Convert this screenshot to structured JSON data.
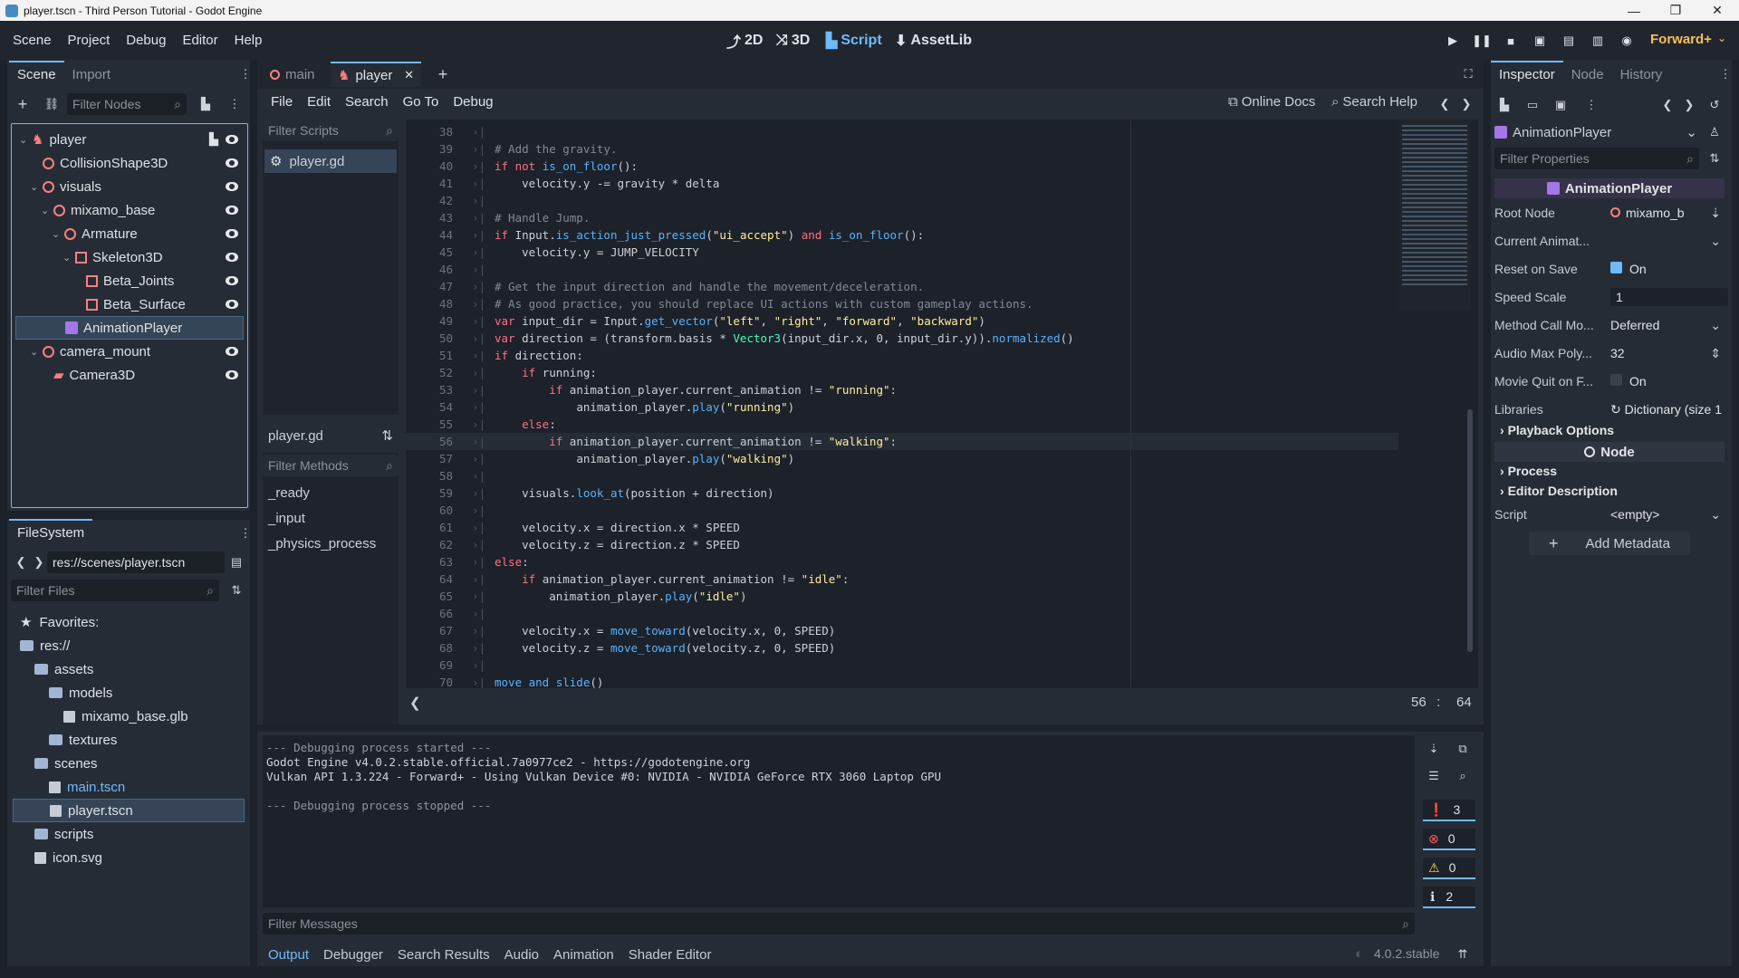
{
  "window": {
    "title": "player.tscn - Third Person Tutorial - Godot Engine",
    "controls": [
      "—",
      "❐",
      "✕"
    ]
  },
  "menu": {
    "items": [
      "Scene",
      "Project",
      "Debug",
      "Editor",
      "Help"
    ]
  },
  "workspaces": [
    "2D",
    "3D",
    "Script",
    "AssetLib"
  ],
  "renderer": "Forward+",
  "scene_dock": {
    "tabs": [
      "Scene",
      "Import"
    ],
    "filter_placeholder": "Filter Nodes",
    "nodes": [
      {
        "label": "player",
        "depth": 0,
        "selected": false,
        "expanded": true,
        "icon": "character-body-icon"
      },
      {
        "label": "CollisionShape3D",
        "depth": 1,
        "selected": false,
        "icon": "collision-shape-icon"
      },
      {
        "label": "visuals",
        "depth": 1,
        "selected": false,
        "expanded": true,
        "icon": "node3d-icon"
      },
      {
        "label": "mixamo_base",
        "depth": 2,
        "selected": false,
        "expanded": true,
        "icon": "node3d-icon"
      },
      {
        "label": "Armature",
        "depth": 3,
        "selected": false,
        "expanded": true,
        "icon": "node3d-icon"
      },
      {
        "label": "Skeleton3D",
        "depth": 4,
        "selected": false,
        "expanded": true,
        "icon": "skeleton-icon"
      },
      {
        "label": "Beta_Joints",
        "depth": 5,
        "selected": false,
        "icon": "mesh-icon"
      },
      {
        "label": "Beta_Surface",
        "depth": 5,
        "selected": false,
        "icon": "mesh-icon"
      },
      {
        "label": "AnimationPlayer",
        "depth": 3,
        "selected": true,
        "icon": "animation-player-icon"
      },
      {
        "label": "camera_mount",
        "depth": 1,
        "selected": false,
        "expanded": true,
        "icon": "node3d-icon"
      },
      {
        "label": "Camera3D",
        "depth": 2,
        "selected": false,
        "icon": "camera-icon"
      }
    ]
  },
  "filesystem": {
    "tab": "FileSystem",
    "path": "res://scenes/player.tscn",
    "filter_placeholder": "Filter Files",
    "items": [
      {
        "label": "Favorites:",
        "depth": 0,
        "kind": "favorites"
      },
      {
        "label": "res://",
        "depth": 0,
        "kind": "folder"
      },
      {
        "label": "assets",
        "depth": 1,
        "kind": "folder"
      },
      {
        "label": "models",
        "depth": 2,
        "kind": "folder"
      },
      {
        "label": "mixamo_base.glb",
        "depth": 3,
        "kind": "file"
      },
      {
        "label": "textures",
        "depth": 2,
        "kind": "folder"
      },
      {
        "label": "scenes",
        "depth": 1,
        "kind": "folder"
      },
      {
        "label": "main.tscn",
        "depth": 2,
        "kind": "file",
        "highlight": true
      },
      {
        "label": "player.tscn",
        "depth": 2,
        "kind": "file",
        "selected": true
      },
      {
        "label": "scripts",
        "depth": 1,
        "kind": "folder"
      },
      {
        "label": "icon.svg",
        "depth": 1,
        "kind": "file"
      }
    ]
  },
  "editor_tabs": [
    {
      "label": "main",
      "active": false
    },
    {
      "label": "player",
      "active": true
    }
  ],
  "script_menu": [
    "File",
    "Edit",
    "Search",
    "Go To",
    "Debug"
  ],
  "script_help": {
    "online_docs": "Online Docs",
    "search_help": "Search Help"
  },
  "scripts_panel": {
    "filter_placeholder": "Filter Scripts",
    "scripts": [
      "player.gd"
    ],
    "current": "player.gd",
    "methods_filter_placeholder": "Filter Methods",
    "methods": [
      "_ready",
      "_input",
      "_physics_process"
    ]
  },
  "code": {
    "cursor_line": "56",
    "cursor_col": "64",
    "highlight_line": 56,
    "lines": [
      {
        "n": 38,
        "t": []
      },
      {
        "n": 39,
        "t": [
          [
            "cm",
            "# Add the gravity."
          ]
        ]
      },
      {
        "n": 40,
        "t": [
          [
            "kw",
            "if not "
          ],
          [
            "fn",
            "is_on_floor"
          ],
          [
            "",
            "():"
          ]
        ]
      },
      {
        "n": 41,
        "t": [
          [
            "",
            "\tvelocity.y -= gravity * delta"
          ]
        ]
      },
      {
        "n": 42,
        "t": []
      },
      {
        "n": 43,
        "t": [
          [
            "cm",
            "# Handle Jump."
          ]
        ]
      },
      {
        "n": 44,
        "t": [
          [
            "kw",
            "if "
          ],
          [
            "",
            "Input."
          ],
          [
            "fn",
            "is_action_just_pressed"
          ],
          [
            "",
            "("
          ],
          [
            "str",
            "\"ui_accept\""
          ],
          [
            "",
            ") "
          ],
          [
            "kw",
            "and "
          ],
          [
            "fn",
            "is_on_floor"
          ],
          [
            "",
            "():"
          ]
        ]
      },
      {
        "n": 45,
        "t": [
          [
            "",
            "\tvelocity.y = JUMP_VELOCITY"
          ]
        ]
      },
      {
        "n": 46,
        "t": []
      },
      {
        "n": 47,
        "t": [
          [
            "cm",
            "# Get the input direction and handle the movement/deceleration."
          ]
        ]
      },
      {
        "n": 48,
        "t": [
          [
            "cm",
            "# As good practice, you should replace UI actions with custom gameplay actions."
          ]
        ]
      },
      {
        "n": 49,
        "t": [
          [
            "kw",
            "var "
          ],
          [
            "",
            "input_dir = Input."
          ],
          [
            "fn",
            "get_vector"
          ],
          [
            "",
            "("
          ],
          [
            "str",
            "\"left\""
          ],
          [
            "",
            ", "
          ],
          [
            "str",
            "\"right\""
          ],
          [
            "",
            ", "
          ],
          [
            "str",
            "\"forward\""
          ],
          [
            "",
            ", "
          ],
          [
            "str",
            "\"backward\""
          ],
          [
            "",
            ")"
          ]
        ]
      },
      {
        "n": 50,
        "t": [
          [
            "kw",
            "var "
          ],
          [
            "",
            "direction = (transform.basis * "
          ],
          [
            "tp",
            "Vector3"
          ],
          [
            "",
            "(input_dir.x, 0, input_dir.y))."
          ],
          [
            "fn",
            "normalized"
          ],
          [
            "",
            "()"
          ]
        ]
      },
      {
        "n": 51,
        "t": [
          [
            "kw",
            "if "
          ],
          [
            "",
            "direction:"
          ]
        ]
      },
      {
        "n": 52,
        "t": [
          [
            "",
            "\t"
          ],
          [
            "kw",
            "if "
          ],
          [
            "",
            "running:"
          ]
        ]
      },
      {
        "n": 53,
        "t": [
          [
            "",
            "\t\t"
          ],
          [
            "kw",
            "if "
          ],
          [
            "",
            "animation_player.current_animation != "
          ],
          [
            "str",
            "\"running\""
          ],
          [
            "",
            ":"
          ]
        ]
      },
      {
        "n": 54,
        "t": [
          [
            "",
            "\t\t\tanimation_player."
          ],
          [
            "fn",
            "play"
          ],
          [
            "",
            "("
          ],
          [
            "str",
            "\"running\""
          ],
          [
            "",
            ")"
          ]
        ]
      },
      {
        "n": 55,
        "t": [
          [
            "",
            "\t"
          ],
          [
            "kw",
            "else"
          ],
          [
            "",
            ":"
          ]
        ]
      },
      {
        "n": 56,
        "t": [
          [
            "",
            "\t\t"
          ],
          [
            "kw",
            "if "
          ],
          [
            "",
            "animation_player.current_animation != "
          ],
          [
            "str",
            "\"walking\""
          ],
          [
            "",
            ":"
          ]
        ]
      },
      {
        "n": 57,
        "t": [
          [
            "",
            "\t\t\tanimation_player."
          ],
          [
            "fn",
            "play"
          ],
          [
            "",
            "("
          ],
          [
            "str",
            "\"walking\""
          ],
          [
            "",
            ")"
          ]
        ]
      },
      {
        "n": 58,
        "t": []
      },
      {
        "n": 59,
        "t": [
          [
            "",
            "\tvisuals."
          ],
          [
            "fn",
            "look_at"
          ],
          [
            "",
            "(position + direction)"
          ]
        ]
      },
      {
        "n": 60,
        "t": []
      },
      {
        "n": 61,
        "t": [
          [
            "",
            "\tvelocity.x = direction.x * SPEED"
          ]
        ]
      },
      {
        "n": 62,
        "t": [
          [
            "",
            "\tvelocity.z = direction.z * SPEED"
          ]
        ]
      },
      {
        "n": 63,
        "t": [
          [
            "kw",
            "else"
          ],
          [
            "",
            ":"
          ]
        ]
      },
      {
        "n": 64,
        "t": [
          [
            "",
            "\t"
          ],
          [
            "kw",
            "if "
          ],
          [
            "",
            "animation_player.current_animation != "
          ],
          [
            "str",
            "\"idle\""
          ],
          [
            "",
            ":"
          ]
        ]
      },
      {
        "n": 65,
        "t": [
          [
            "",
            "\t\tanimation_player."
          ],
          [
            "fn",
            "play"
          ],
          [
            "",
            "("
          ],
          [
            "str",
            "\"idle\""
          ],
          [
            "",
            ")"
          ]
        ]
      },
      {
        "n": 66,
        "t": []
      },
      {
        "n": 67,
        "t": [
          [
            "",
            "\tvelocity.x = "
          ],
          [
            "fn",
            "move_toward"
          ],
          [
            "",
            "(velocity.x, 0, SPEED)"
          ]
        ]
      },
      {
        "n": 68,
        "t": [
          [
            "",
            "\tvelocity.z = "
          ],
          [
            "fn",
            "move_toward"
          ],
          [
            "",
            "(velocity.z, 0, SPEED)"
          ]
        ]
      },
      {
        "n": 69,
        "t": []
      },
      {
        "n": 70,
        "t": [
          [
            "fn",
            "move_and_slide"
          ],
          [
            "",
            "()"
          ]
        ]
      }
    ]
  },
  "output": {
    "lines": [
      "--- Debugging process started ---",
      "Godot Engine v4.0.2.stable.official.7a0977ce2 - https://godotengine.org",
      "Vulkan API 1.3.224 - Forward+ - Using Vulkan Device #0: NVIDIA - NVIDIA GeForce RTX 3060 Laptop GPU",
      "",
      "--- Debugging process stopped ---"
    ],
    "filter_placeholder": "Filter Messages",
    "counts": [
      "3",
      "0",
      "0",
      "2"
    ]
  },
  "bottom_tabs": [
    "Output",
    "Debugger",
    "Search Results",
    "Audio",
    "Animation",
    "Shader Editor"
  ],
  "version": "4.0.2.stable",
  "inspector": {
    "tabs": [
      "Inspector",
      "Node",
      "History"
    ],
    "object": "AnimationPlayer",
    "filter_placeholder": "Filter Properties",
    "class_header": "AnimationPlayer",
    "props": [
      {
        "label": "Root Node",
        "value": "mixamo_b"
      },
      {
        "label": "Current Animat...",
        "value": ""
      },
      {
        "label": "Reset on Save",
        "value": "On",
        "check": true
      },
      {
        "label": "Speed Scale",
        "value": "1"
      },
      {
        "label": "Method Call Mo...",
        "value": "Deferred"
      },
      {
        "label": "Audio Max Poly...",
        "value": "32"
      },
      {
        "label": "Movie Quit on F...",
        "value": "On",
        "check": false
      },
      {
        "label": "Libraries",
        "value": "Dictionary (size 1"
      }
    ],
    "playback_section": "Playback Options",
    "node_header": "Node",
    "process_section": "Process",
    "editor_desc_section": "Editor Description",
    "script_label": "Script",
    "script_value": "<empty>",
    "add_metadata": "Add Metadata"
  },
  "colors": {
    "accent": "#70bafa",
    "node": "#fc7f7f",
    "anim": "#a377e8"
  }
}
